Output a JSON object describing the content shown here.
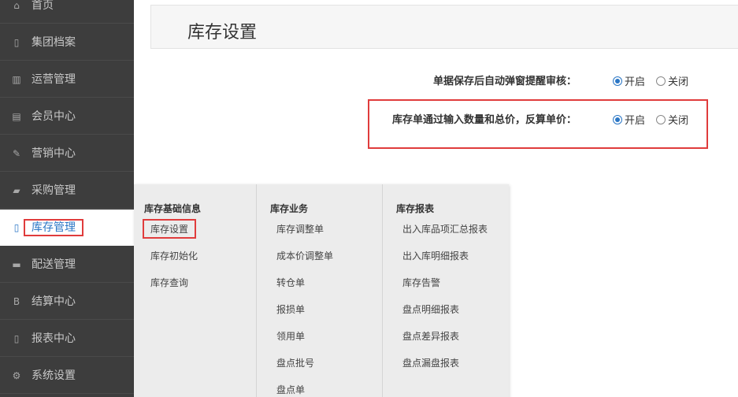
{
  "sidebar": {
    "items": [
      {
        "label": "首页",
        "icon": "home-icon",
        "glyph": "⌂"
      },
      {
        "label": "集团档案",
        "icon": "file-icon",
        "glyph": "▯"
      },
      {
        "label": "运营管理",
        "icon": "bar-chart-icon",
        "glyph": "▥"
      },
      {
        "label": "会员中心",
        "icon": "id-card-icon",
        "glyph": "▤"
      },
      {
        "label": "营销中心",
        "icon": "edit-icon",
        "glyph": "✎"
      },
      {
        "label": "采购管理",
        "icon": "book-icon",
        "glyph": "▰"
      },
      {
        "label": "库存管理",
        "icon": "document-icon",
        "glyph": "▯"
      },
      {
        "label": "配送管理",
        "icon": "truck-icon",
        "glyph": "▬"
      },
      {
        "label": "结算中心",
        "icon": "bitcoin-icon",
        "glyph": "B"
      },
      {
        "label": "报表中心",
        "icon": "report-icon",
        "glyph": "▯"
      },
      {
        "label": "系统设置",
        "icon": "gears-icon",
        "glyph": "⚙"
      }
    ],
    "active_index": 6
  },
  "header": {
    "title": "库存设置"
  },
  "settings": [
    {
      "question": "单据保存后自动弹窗提醒审核：",
      "on_label": "开启",
      "off_label": "关闭",
      "selected": "on"
    },
    {
      "question": "库存单通过输入数量和总价，反算单价：",
      "on_label": "开启",
      "off_label": "关闭",
      "selected": "on"
    }
  ],
  "menu": {
    "columns": [
      {
        "heading": "库存基础信息",
        "items": [
          "库存设置",
          "库存初始化",
          "库存查询"
        ]
      },
      {
        "heading": "库存业务",
        "items": [
          "库存调整单",
          "成本价调整单",
          "转仓单",
          "报损单",
          "领用单",
          "盘点批号",
          "盘点单"
        ]
      },
      {
        "heading": "库存报表",
        "items": [
          "出入库品项汇总报表",
          "出入库明细报表",
          "库存告警",
          "盘点明细报表",
          "盘点差异报表",
          "盘点漏盘报表"
        ]
      }
    ]
  },
  "colors": {
    "accent": "#2a76c5",
    "highlight": "#e03c3c",
    "sidebar_bg": "#3d3d3d"
  }
}
